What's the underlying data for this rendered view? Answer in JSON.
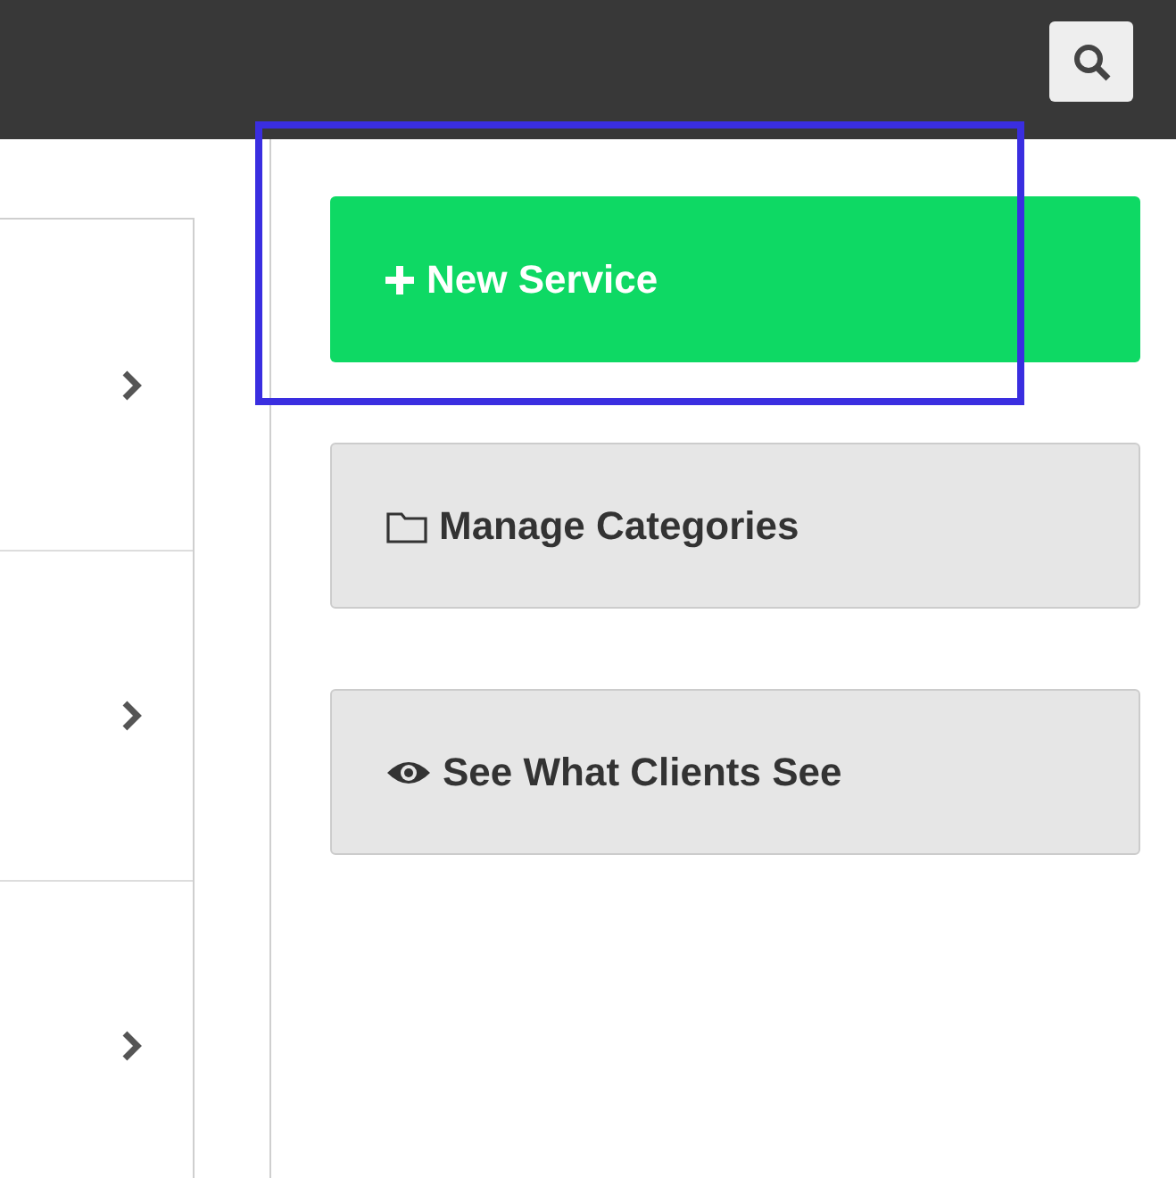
{
  "list_rows": [
    {
      "kind": "chevron"
    },
    {
      "kind": "chevron"
    },
    {
      "kind": "chevron"
    }
  ],
  "actions": [
    {
      "label": "New Service",
      "kind": "add"
    },
    {
      "label": "Manage Categories",
      "kind": "folder"
    },
    {
      "label": "See What Clients See",
      "kind": "eye"
    }
  ]
}
